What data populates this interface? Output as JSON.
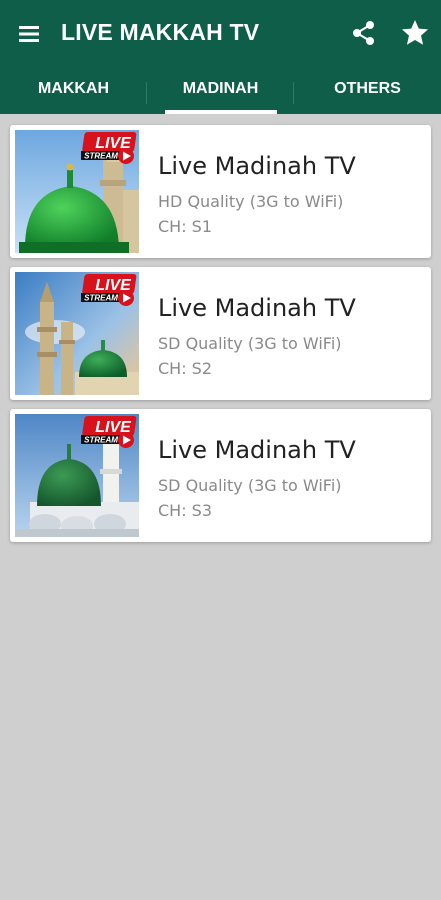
{
  "app": {
    "title": "LIVE MAKKAH TV",
    "theme_color": "#0e5e4a",
    "icons": {
      "menu": "hamburger-menu-icon",
      "share": "share-icon",
      "favorite": "star-icon"
    }
  },
  "tabs": [
    {
      "label": "MAKKAH",
      "selected": false
    },
    {
      "label": "MADINAH",
      "selected": true
    },
    {
      "label": "OTHERS",
      "selected": false
    }
  ],
  "channels": [
    {
      "title": "Live Madinah TV",
      "quality": "HD Quality (3G to WiFi)",
      "channel": "CH: S1",
      "badge_top": "LIVE",
      "badge_bottom": "STREAM"
    },
    {
      "title": "Live Madinah TV",
      "quality": "SD Quality (3G to WiFi)",
      "channel": "CH: S2",
      "badge_top": "LIVE",
      "badge_bottom": "STREAM"
    },
    {
      "title": "Live Madinah TV",
      "quality": "SD Quality (3G to WiFi)",
      "channel": "CH: S3",
      "badge_top": "LIVE",
      "badge_bottom": "STREAM"
    }
  ]
}
